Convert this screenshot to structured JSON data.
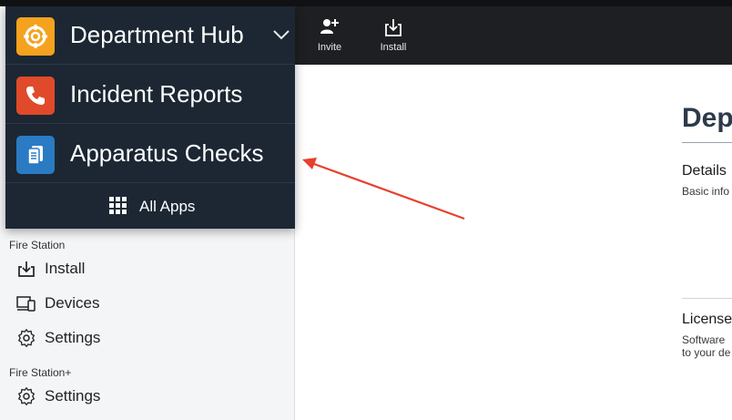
{
  "toolbar": {
    "invite_label": "Invite",
    "install_label": "Install"
  },
  "app_switcher": {
    "current_app": "Department Hub",
    "apps": [
      {
        "name": "Incident Reports"
      },
      {
        "name": "Apparatus Checks"
      }
    ],
    "all_apps_label": "All Apps",
    "colors": {
      "department_hub_tile": "#f5a21f",
      "incident_reports_tile": "#e04a2a",
      "apparatus_checks_tile": "#2a7bc4",
      "panel_bg": "#1c2733"
    }
  },
  "sidebar": {
    "sections": [
      {
        "label": "Fire Station",
        "items": [
          {
            "label": "Install",
            "icon": "install-icon"
          },
          {
            "label": "Devices",
            "icon": "devices-icon"
          },
          {
            "label": "Settings",
            "icon": "gear-icon"
          }
        ]
      },
      {
        "label": "Fire Station+",
        "items": [
          {
            "label": "Settings",
            "icon": "gear-icon"
          }
        ]
      }
    ]
  },
  "main": {
    "title": "Depa",
    "details_heading": "Details",
    "details_text": "Basic info",
    "license_heading": "License",
    "license_text_line1": "Software",
    "license_text_line2": "to your de"
  },
  "annotation": {
    "arrow_color": "#e8402a"
  }
}
